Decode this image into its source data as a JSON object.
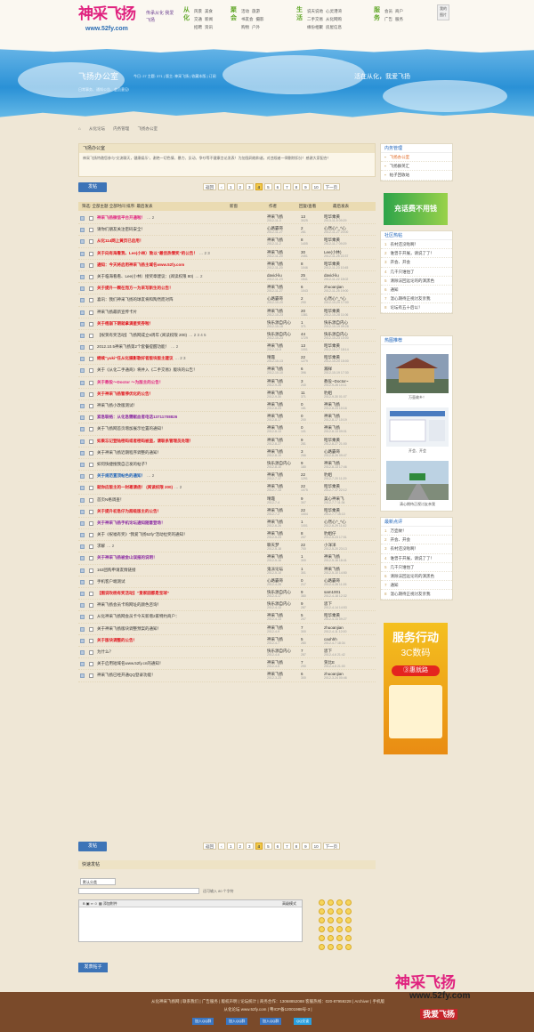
{
  "header": {
    "logo_text": "神采飞扬",
    "logo_url": "www.52fy.com",
    "slogan": "传承从化 我爱飞扬",
    "nav": [
      {
        "cat": "从化",
        "links": [
          "风景",
          "美食",
          "交通",
          "新闻",
          "招聘",
          "资讯"
        ]
      },
      {
        "cat": "聚会",
        "links": [
          "活动",
          "旅游",
          "书友会",
          "摄影",
          "购物",
          "户外"
        ]
      },
      {
        "cat": "生活",
        "links": [
          "说天说地",
          "心灵港湾",
          "二手交易",
          "从化网购",
          "缘份相聚",
          "房屋信息"
        ]
      },
      {
        "cat": "服务",
        "links": [
          "会员",
          "商户",
          "广告",
          "服务"
        ]
      }
    ],
    "corner_links": [
      "我的",
      "图片"
    ]
  },
  "forum": {
    "name": "飞扬办公室",
    "stats": "今日: 27  主题: 371 | 版主: 神采飞扬 | 收藏本版 | 订阅",
    "desc": "日常事务、通知公告、会员意见!",
    "slogan": "活在从化，我爱飞扬"
  },
  "breadcrumb": [
    "从化论坛",
    "内务管理",
    "飞扬办公室"
  ],
  "notice": {
    "title": "飞扬办公室",
    "text": "神采飞扬特邀您参与“交流聊天，健康娱乐”，谢绝一切色情、暴力、反动、争吵等不健康言论发表！为加强网络和谐，对违规者一律删除扣分！感谢大家配合！"
  },
  "toolbar": {
    "post_label": "发帖",
    "back_label": "返回",
    "next_label": "下一页",
    "pages": [
      "1",
      "2",
      "3",
      "4",
      "5",
      "6",
      "7",
      "8",
      "9",
      "10"
    ],
    "current_page": "4"
  },
  "thead": {
    "filter": "筛选: 全部主题  全部时间  排序: 最后发表",
    "new_window": "新窗",
    "author": "作者",
    "count": "回复/查看",
    "last": "最后发表"
  },
  "threads": [
    {
      "title": "神采飞扬微信平台开通啦！",
      "cls": "pink",
      "pages": "… 2",
      "author": "神采飞扬",
      "date": "2012-11-3",
      "replies": "13",
      "views": "3025",
      "last": "昭华乘黄",
      "ltime": "2013-11-5 09:29"
    },
    {
      "title": "请你们朋友关注密码安全！",
      "cls": "",
      "pages": "",
      "author": "心路霸哥",
      "date": "2012-11-27",
      "replies": "2",
      "views": "281",
      "last": "心然心^_^心",
      "ltime": "2012-11-27 20:00"
    },
    {
      "title": "从化114网上黄页已启用！",
      "cls": "red",
      "pages": "",
      "author": "神采飞扬",
      "date": "2012-11-2",
      "replies": "8",
      "views": "1405",
      "last": "昭华乘黄",
      "ltime": "2012-11-7 09:29"
    },
    {
      "title": "关于向有海看我、Lee(小林）致以“最佳热情奖”的公告！",
      "cls": "red",
      "pages": "… 2 3",
      "author": "神采飞扬",
      "date": "2012-11-20",
      "replies": "30",
      "views": "2451",
      "last": "Lee(小林)",
      "ltime": "2012-11-25 22:37"
    },
    {
      "title": "通知：今天将启用神采飞扬主域名www.52fy.com",
      "cls": "red",
      "pages": "",
      "author": "神采飞扬",
      "date": "2012-11-20",
      "replies": "8",
      "views": "1046",
      "last": "昭华乘黄",
      "ltime": "2012-11-23 10:45"
    },
    {
      "title": "关于临海看看、Lee(小林）接奖章建议：(阅读权限 80)",
      "cls": "",
      "pages": "… 2",
      "author": "david-liu",
      "date": "2012-11-23",
      "replies": "25",
      "views": "1541",
      "last": "david-liu",
      "ltime": "2012-11-22 18:02"
    },
    {
      "title": "关于提升一颗在而方一为采写新生的公告！",
      "cls": "red",
      "pages": "",
      "author": "神采飞扬",
      "date": "2012-11-27",
      "replies": "6",
      "views": "1043",
      "last": "zhuoanjian",
      "ltime": "2012-11-25 19:00"
    },
    {
      "title": "喜讯：我们神采飞扬的球友将和陶然而对阵",
      "cls": "",
      "pages": "",
      "author": "心路霸哥",
      "date": "2012-10-20",
      "replies": "2",
      "views": "290",
      "last": "心然心^_^心",
      "ltime": "2012-10-29 17:00"
    },
    {
      "title": "神采飞扬最新宣传卡片",
      "cls": "",
      "pages": "",
      "author": "神采飞扬",
      "date": "2012-10-23",
      "replies": "20",
      "views": "1381",
      "last": "昭华乘黄",
      "ltime": "2012-10-28 11:06"
    },
    {
      "title": "关于梧崩下期就拿满星奖券啦！",
      "cls": "red",
      "pages": "",
      "author": "快乐源自内心",
      "date": "2012-10-18",
      "replies": "1",
      "views": "371",
      "last": "快乐源自内心",
      "ltime": "2012-10-19 09:28"
    },
    {
      "title": "【祝贺有奖活动】飞扬网成立6周年 (阅读权限 200)",
      "cls": "",
      "pages": "… 2 3 4 5",
      "author": "快乐源自内心",
      "date": "2012-10-23",
      "replies": "44",
      "views": "1729",
      "last": "快乐源自内心",
      "ltime": "2012-10-23 10:00"
    },
    {
      "title": "2012.10.5神采飞扬第2个套餐提醒功能！",
      "cls": "",
      "pages": "… 2",
      "author": "神采飞扬",
      "date": "2012-10-5",
      "replies": "13",
      "views": "1001",
      "last": "昭华乘黄",
      "ltime": "2012-10-17 18:14"
    },
    {
      "title": "继续“yuki”任从化摄影歌好者版块版主建议",
      "cls": "red",
      "pages": "… 2 3",
      "author": "晴霞",
      "date": "2012-10-13",
      "replies": "22",
      "views": "1279",
      "last": "昭华乘黄",
      "ltime": "2012-10-20 15:00"
    },
    {
      "title": "关于《从化二手通商》将并入《二手交易》版块的公告！",
      "cls": "",
      "pages": "",
      "author": "神采飞扬",
      "date": "2012-10-10",
      "replies": "6",
      "views": "396",
      "last": "瀚祥",
      "ltime": "2012-10-19 17:30"
    },
    {
      "title": "关于教役～Doctor ～为版主的公告！",
      "cls": "pink",
      "pages": "",
      "author": "神采飞扬",
      "date": "2012-9-28",
      "replies": "3",
      "views": "240",
      "last": "教役~Doctor~",
      "ltime": "2012-9-28 10:11"
    },
    {
      "title": "关于神采飞扬暂停优化的公告！",
      "cls": "red",
      "pages": "",
      "author": "神采飞扬",
      "date": "2012-9-30",
      "replies": "11",
      "views": "371",
      "last": "豹姐",
      "ltime": "2012-9-30 01:07"
    },
    {
      "title": "神采飞扬小改版测试！",
      "cls": "",
      "pages": "",
      "author": "神采飞扬",
      "date": "2012-8-23",
      "replies": "0",
      "views": "181",
      "last": "神采飞扬",
      "ltime": "2012-8-23 10:16"
    },
    {
      "title": "紧急联络：从化急需献血者电话13711708826",
      "cls": "purple",
      "pages": "",
      "author": "神采飞扬",
      "date": "2012-8-17",
      "replies": "0",
      "views": "200",
      "last": "神采飞扬",
      "ltime": "2012-8-17 10:19"
    },
    {
      "title": "关于飞扬网首页增加展示位置的通知！",
      "cls": "",
      "pages": "",
      "author": "神采飞扬",
      "date": "2012-8-13",
      "replies": "0",
      "views": "101",
      "last": "神采飞扬",
      "ltime": "2012-8-13 09:01"
    },
    {
      "title": "如果忘记登陆密码或者密码被盗，请联系管理员处理！",
      "cls": "red",
      "pages": "",
      "author": "神采飞扬",
      "date": "2012-8-27",
      "replies": "9",
      "views": "281",
      "last": "昭华乘黄",
      "ltime": "2012-8-27 21:00"
    },
    {
      "title": "关于神采飞扬近期程序调整的通知！",
      "cls": "",
      "pages": "",
      "author": "神采飞扬",
      "date": "2012-8-19",
      "replies": "3",
      "views": "266",
      "last": "心路霸哥",
      "ltime": "2012-8-26 09:47"
    },
    {
      "title": "如何快捷搜我自己发的帖子？",
      "cls": "",
      "pages": "",
      "author": "快乐源自内心",
      "date": "2012-8-10",
      "replies": "9",
      "views": "180",
      "last": "神采飞扬",
      "ltime": "2012-8-13 17:46"
    },
    {
      "title": "关于规范置顶帖色的通知！",
      "cls": "blue",
      "pages": "… 2",
      "author": "神采飞扬",
      "date": "2012-7-17",
      "replies": "22",
      "views": "1291",
      "last": "豹姐",
      "ltime": "2012-7-20 11:29"
    },
    {
      "title": "就你应版主的一封邀请函！ (阅读权限 200)",
      "cls": "red",
      "pages": "… 2",
      "author": "神采飞扬",
      "date": "2012-7-13",
      "replies": "22",
      "views": "1075",
      "last": "昭华乘黄",
      "ltime": "2012-7-17 22:12"
    },
    {
      "title": "首页N格调查！",
      "cls": "",
      "pages": "",
      "author": "晴霞",
      "date": "2012-7-4",
      "replies": "9",
      "views": "307",
      "last": "美心神采飞",
      "ltime": "2012-7-7 11:34"
    },
    {
      "title": "关于提升初急仔为超级版主的公告！",
      "cls": "red",
      "pages": "",
      "author": "神采飞扬",
      "date": "2012-7-2",
      "replies": "22",
      "views": "1004",
      "last": "昭华乘黄",
      "ltime": "2012-7-7 15:10"
    },
    {
      "title": "关于神采飞扬手机论坛通知随意登场！",
      "cls": "purple",
      "pages": "",
      "author": "神采飞扬",
      "date": "2012-6-26",
      "replies": "1",
      "views": "1001",
      "last": "心然心^_^心",
      "ltime": "2012-6-29 11:42"
    },
    {
      "title": "关于《祝福有奖》“我爱飞扬52fy”活动拉奖的通知！",
      "cls": "",
      "pages": "",
      "author": "神采飞扬",
      "date": "2012-5-23",
      "replies": "8",
      "views": "207",
      "last": "豹姐仔",
      "ltime": "2012-5-23 17:51"
    },
    {
      "title": "求解",
      "cls": "",
      "pages": "… 2",
      "author": "聊天梦",
      "date": "2012-5-18",
      "replies": "22",
      "views": "700",
      "last": "小洋洋",
      "ltime": "2012-5-20 23:13"
    },
    {
      "title": "关于神采飞扬被金山误报的说明！",
      "cls": "purple",
      "pages": "",
      "author": "神采飞扬",
      "date": "2012-5-16",
      "replies": "1",
      "views": "300",
      "last": "神采飞扬",
      "ltime": "2012-5-16 16:41"
    },
    {
      "title": "163团购申请友情链接",
      "cls": "",
      "pages": "",
      "author": "鬼派论坛",
      "date": "2012-5-10",
      "replies": "1",
      "views": "301",
      "last": "神采飞扬",
      "ltime": "2012-5-10 14:50"
    },
    {
      "title": "手机客户端测试",
      "cls": "",
      "pages": "",
      "author": "心路霸哥",
      "date": "2012-4-28",
      "replies": "0",
      "views": "217",
      "last": "心路霸哥",
      "ltime": "2012-4-28 11:26"
    },
    {
      "title": "【图说吹杨有奖活动】“爱家园都是宝球”",
      "cls": "red",
      "pages": "",
      "author": "快乐源自内心",
      "date": "2012-4-17",
      "replies": "9",
      "views": "380",
      "last": "sam1001",
      "ltime": "2012-4-18 12:32"
    },
    {
      "title": "神采飞扬会员卡购网址的颜色咨询！",
      "cls": "",
      "pages": "",
      "author": "快乐源自内心",
      "date": "2012-4-13",
      "replies": "9",
      "views": "287",
      "last": "思下",
      "ltime": "2012-4-14 14:53"
    },
    {
      "title": "从化神采飞扬网会员卡今天新增2家特约商户：",
      "cls": "",
      "pages": "",
      "author": "神采飞扬",
      "date": "2012-4-13",
      "replies": "5",
      "views": "207",
      "last": "昭华乘黄",
      "ltime": "2012-4-14 09:27"
    },
    {
      "title": "关于神采飞扬版块调整预案的通知！",
      "cls": "",
      "pages": "",
      "author": "神采飞扬",
      "date": "2012-4-9",
      "replies": "7",
      "views": "300",
      "last": "zhuoanjian",
      "ltime": "2012-4-11 12:00"
    },
    {
      "title": "关于版块调整的公告！",
      "cls": "red",
      "pages": "",
      "author": "神采飞扬",
      "date": "2012-4-7",
      "replies": "5",
      "views": "280",
      "last": "caohhh",
      "ltime": "2012-4-7 18:34"
    },
    {
      "title": "为什么？",
      "cls": "",
      "pages": "",
      "author": "快乐源自内心",
      "date": "2012-4-6",
      "replies": "7",
      "views": "287",
      "last": "思下",
      "ltime": "2012-4-6 21:42"
    },
    {
      "title": "关于启用短域名www.52fy.cn的通知！",
      "cls": "",
      "pages": "",
      "author": "神采飞扬",
      "date": "2012-4-5",
      "replies": "7",
      "views": "290",
      "last": "贺比E",
      "ltime": "2012-4-5 21:00"
    },
    {
      "title": "神采飞扬已经开通QQ登录功能！",
      "cls": "",
      "pages": "",
      "author": "神采飞扬",
      "date": "2012-3-23",
      "replies": "6",
      "views": "300",
      "last": "zhuoanjian",
      "ltime": "2012-3-24 00:46"
    }
  ],
  "quick_reply": {
    "title": "快速发帖",
    "category": "默认分类",
    "limit_text": "还可输入 80 个字符",
    "attach_label": "添加附件",
    "advanced_label": "高级模式",
    "submit_label": "发表帖子"
  },
  "sidebar": {
    "menu_title": "内务管理",
    "menu": [
      "飞扬办公室",
      "飞扬群英汇",
      "帖子回收站"
    ],
    "ad1_text": "充话费不用钱",
    "hot_title": "社区热帖",
    "hot": [
      "农村还没啦啊！",
      "谁曾于开展，请说了了！",
      "开会、开会",
      "几千只谁怕了",
      "清除法回远论的的演黑色",
      "通知",
      "温心期待正视讨友亲我",
      "论坛有五十后以！"
    ],
    "recommend_title": "热图推荐",
    "recommend": [
      "万壶故乡！",
      "开会、开会",
      "清心期待正视讨友亲我"
    ],
    "latest_title": "最新点评",
    "latest": [
      "万壶故！",
      "开会、开会",
      "农村还没啦啊！",
      "谁曾于开展，请说了了！",
      "几千只谁怕了",
      "清除法回远论的的演黑色",
      "通知",
      "温心期待正视讨友亲我"
    ],
    "ad2_title": "服务行动",
    "ad2_sub": "3C数码",
    "ad2_cta": "③惠就路"
  },
  "footer": {
    "line1": "从化神采飞扬网 | 联系我们 | 广告服务 | 版权声明 | 论坛统计 | 商务合作：13068852088 客服热线：020-87959228 | Archiver | 手机版",
    "line2": "从化论坛 www.52fy.com | 粤ICP备12001988号-3 |",
    "qq_buttons": [
      "加入QQ群",
      "加入QQ群",
      "加入QQ群",
      "QQ交谈"
    ],
    "logo_text": "神采飞扬",
    "logo_url": "www.52fy.com",
    "slogan": "我爱飞扬"
  },
  "colors": {
    "accent": "#3d74b7",
    "brand": "#e0227f",
    "highlight": "#f1c94a"
  }
}
